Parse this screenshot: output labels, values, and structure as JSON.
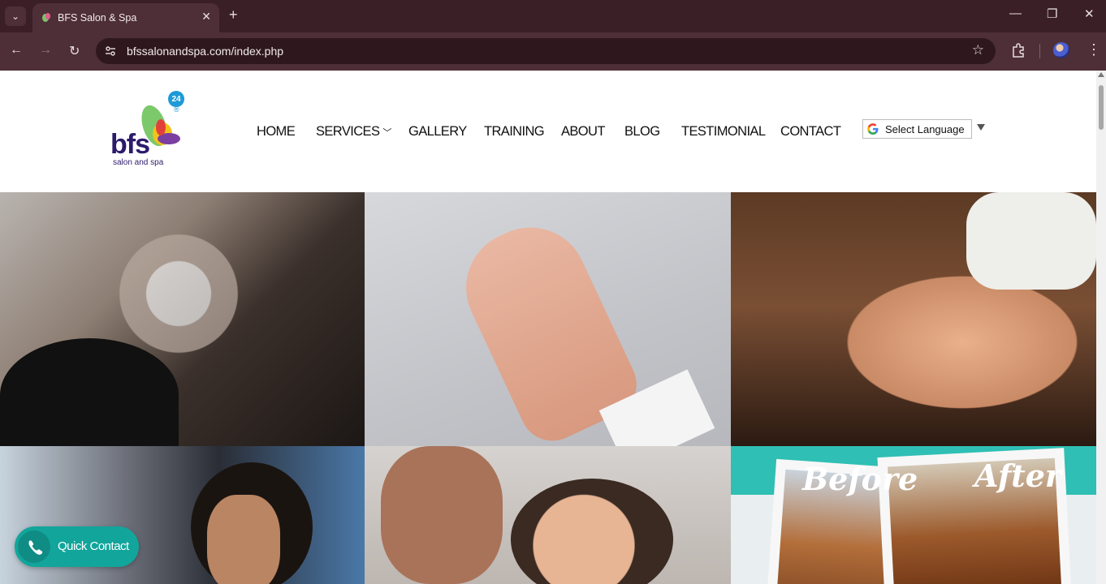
{
  "browser": {
    "tab_title": "BFS Salon & Spa",
    "url": "bfssalonandspa.com/index.php",
    "new_tab": "+",
    "close_tab": "✕"
  },
  "logo": {
    "brand": "bfs",
    "sub": "salon and spa",
    "badge": "24",
    "registered": "®"
  },
  "nav": {
    "items": [
      "HOME",
      "SERVICES",
      "GALLERY",
      "TRAINING",
      "ABOUT",
      "BLOG",
      "TESTIMONIAL",
      "CONTACT"
    ]
  },
  "language": {
    "label": "Select Language"
  },
  "gallery": {
    "before_label": "Before",
    "after_label": "After"
  },
  "quick_contact": {
    "label": "Quick Contact"
  },
  "colors": {
    "chrome": "#3a1f26",
    "toolbar": "#4e2f37",
    "accent": "#12a59b",
    "logo_purple": "#2c1a6b",
    "logo_blue": "#1e9ad6"
  }
}
